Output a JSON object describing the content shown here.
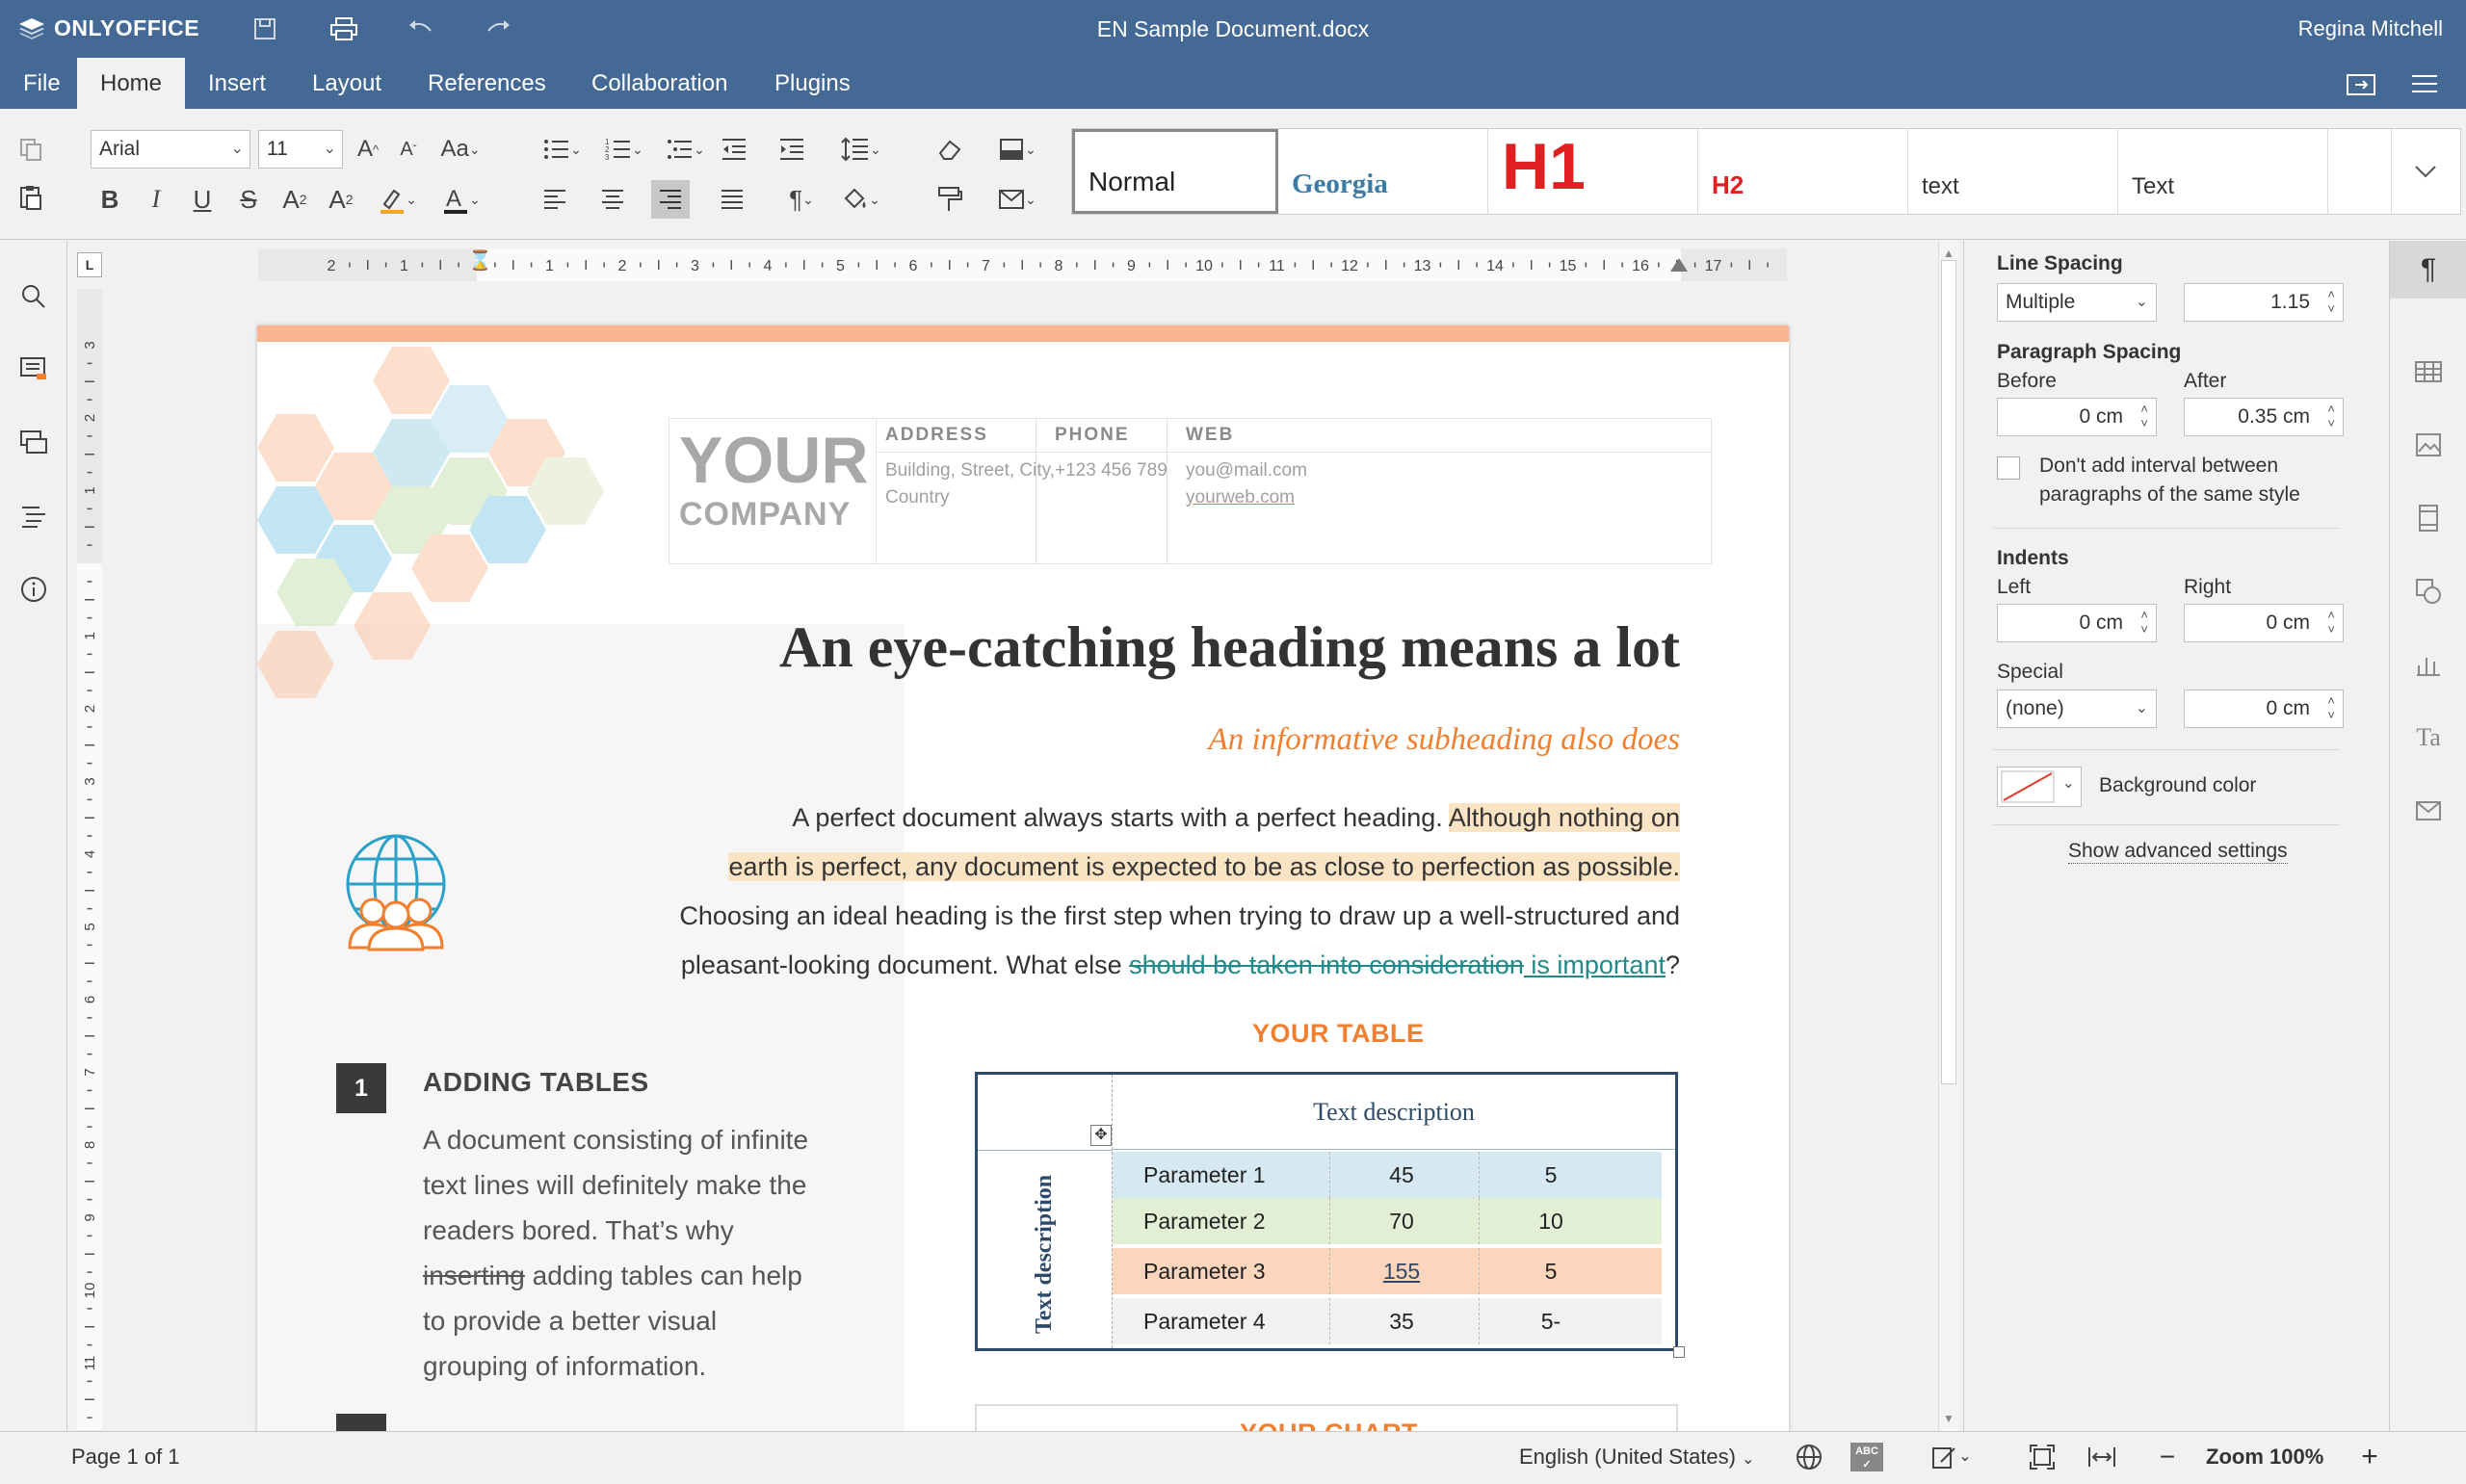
{
  "app": {
    "brand": "ONLYOFFICE",
    "title": "EN Sample Document.docx",
    "user": "Regina Mitchell"
  },
  "menu": {
    "tabs": [
      "File",
      "Home",
      "Insert",
      "Layout",
      "References",
      "Collaboration",
      "Plugins"
    ],
    "active": "Home"
  },
  "toolbar": {
    "font_name": "Arial",
    "font_size": "11",
    "styles": [
      {
        "label": "Normal",
        "selected": true
      },
      {
        "label": "Georgia"
      },
      {
        "label": "H1"
      },
      {
        "label": "H2"
      },
      {
        "label": "text"
      },
      {
        "label": "Text"
      }
    ]
  },
  "document": {
    "company": {
      "your": "YOUR",
      "company": "COMPANY"
    },
    "columns": [
      {
        "header": "ADDRESS",
        "line1": "Building, Street, City,",
        "line2": "Country"
      },
      {
        "header": "PHONE",
        "line1": "+123 456 789",
        "line2": ""
      },
      {
        "header": "WEB",
        "line1": "you@mail.com",
        "line2": "yourweb.com"
      }
    ],
    "heading": "An eye-catching heading means a lot",
    "subheading": "An informative subheading also does",
    "body": {
      "l1a": "A perfect document always starts with a perfect heading. ",
      "l1b": "Although nothing on",
      "l2": "earth is perfect, any document is expected to be as close to perfection as possible.",
      "l3": "Choosing an ideal heading is the first step when trying to draw up a well-structured and",
      "l4a": "pleasant-looking document. What else ",
      "l4del": "should be taken into consideration",
      "l4ins": " is important",
      "l4end": "?"
    },
    "section1": {
      "number": "1",
      "title": "ADDING TABLES",
      "lines": [
        "A document consisting of infinite",
        "text lines will definitely make the",
        "readers bored. That’s why",
        "",
        "to provide a better visual",
        "grouping of information."
      ],
      "line4_del": "inserting",
      "line4_rest": " adding tables can help"
    },
    "table": {
      "title": "YOUR TABLE",
      "top_desc": "Text description",
      "side_desc": "Text description",
      "rows": [
        {
          "name": "Parameter 1",
          "v1": "45",
          "v2": "5",
          "color": "#d6e9f2"
        },
        {
          "name": "Parameter 2",
          "v1": "70",
          "v2": "10",
          "color": "#e2efd5"
        },
        {
          "name": "Parameter 3",
          "v1": "155",
          "v2": "5",
          "color": "#fbd5bc"
        },
        {
          "name": "Parameter 4",
          "v1": "35",
          "v2": "5-",
          "color": "#f1f1f1"
        }
      ]
    },
    "chart_title": "YOUR CHART"
  },
  "right_panel": {
    "line_spacing_label": "Line Spacing",
    "line_spacing_type": "Multiple",
    "line_spacing_value": "1.15",
    "para_spacing_label": "Paragraph Spacing",
    "before_label": "Before",
    "before_value": "0 cm",
    "after_label": "After",
    "after_value": "0.35 cm",
    "no_interval_line1": "Don't add interval between",
    "no_interval_line2": "paragraphs of the same style",
    "indents_label": "Indents",
    "left_label": "Left",
    "left_value": "0 cm",
    "right_label": "Right",
    "right_value": "0 cm",
    "special_label": "Special",
    "special_type": "(none)",
    "special_value": "0 cm",
    "bg_color_label": "Background color",
    "advanced_link": "Show advanced settings"
  },
  "ruler": {
    "h_numbers": [
      "2",
      "1",
      "",
      "1",
      "2",
      "3",
      "4",
      "5",
      "6",
      "7",
      "8",
      "9",
      "10",
      "11",
      "12",
      "13",
      "14",
      "15",
      "16",
      "17"
    ],
    "v_numbers": [
      "3",
      "2",
      "1",
      "",
      "1",
      "2",
      "3",
      "4",
      "5",
      "6",
      "7",
      "8",
      "9",
      "10",
      "11"
    ]
  },
  "status": {
    "page": "Page 1 of 1",
    "language": "English (United States)",
    "zoom": "Zoom 100%"
  },
  "colors": {
    "header": "#446995",
    "accent": "#f07f2f",
    "heading": "#333333",
    "h1": "#e02020",
    "table_border": "#2e4a6b"
  }
}
